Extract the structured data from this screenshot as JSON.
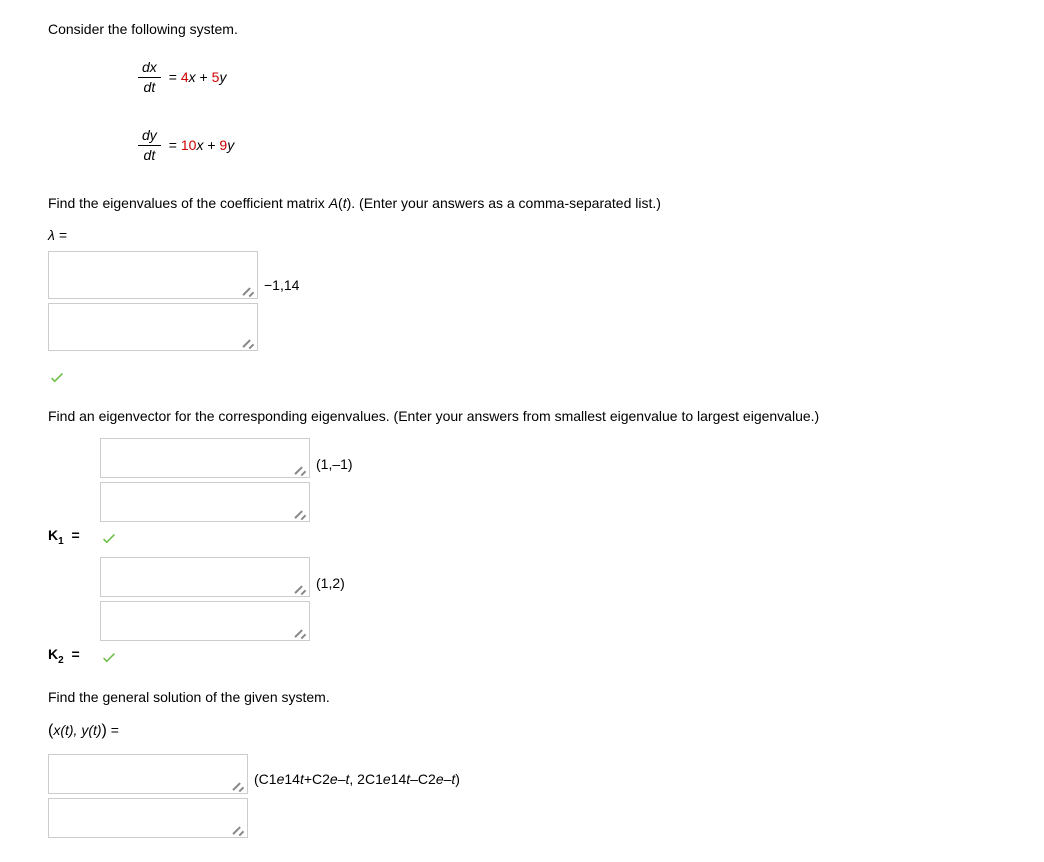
{
  "intro": "Consider the following system.",
  "eq1": {
    "num": "dx",
    "den": "dt",
    "a": "4",
    "b": "5"
  },
  "eq2": {
    "num": "dy",
    "den": "dt",
    "c": "10",
    "d": "9"
  },
  "eigenvalues_prompt": "Find the eigenvalues of the coefficient matrix A(t). (Enter your answers as a comma-separated list.)",
  "lambda_label": "λ =",
  "lambda_answer": "−1,14",
  "eigenvector_prompt": "Find an eigenvector for the corresponding eigenvalues. (Enter your answers from smallest eigenvalue to largest eigenvalue.)",
  "k1_label": "K",
  "k1_sub": "1",
  "k1_answer": "(1,–1)",
  "k2_label": "K",
  "k2_sub": "2",
  "k2_answer": "(1,2)",
  "general_prompt": "Find the general solution of the given system.",
  "general_lhs_open": "(",
  "general_lhs_x": "x(t), y(t)",
  "general_lhs_close": ")",
  "general_eq": " = ",
  "general_answer_p1": "(C1",
  "general_answer_p2": "e",
  "general_answer_p3": "14",
  "general_answer_p4": "t",
  "general_answer_p5": "+C2",
  "general_answer_p6": "e",
  "general_answer_p7": "–",
  "general_answer_p8": "t",
  "general_answer_p9": ", 2C1",
  "general_answer_p10": "e",
  "general_answer_p11": "14",
  "general_answer_p12": "t",
  "general_answer_p13": "–C2",
  "general_answer_p14": "e",
  "general_answer_p15": "–",
  "general_answer_p16": "t",
  "general_answer_p17": ")"
}
